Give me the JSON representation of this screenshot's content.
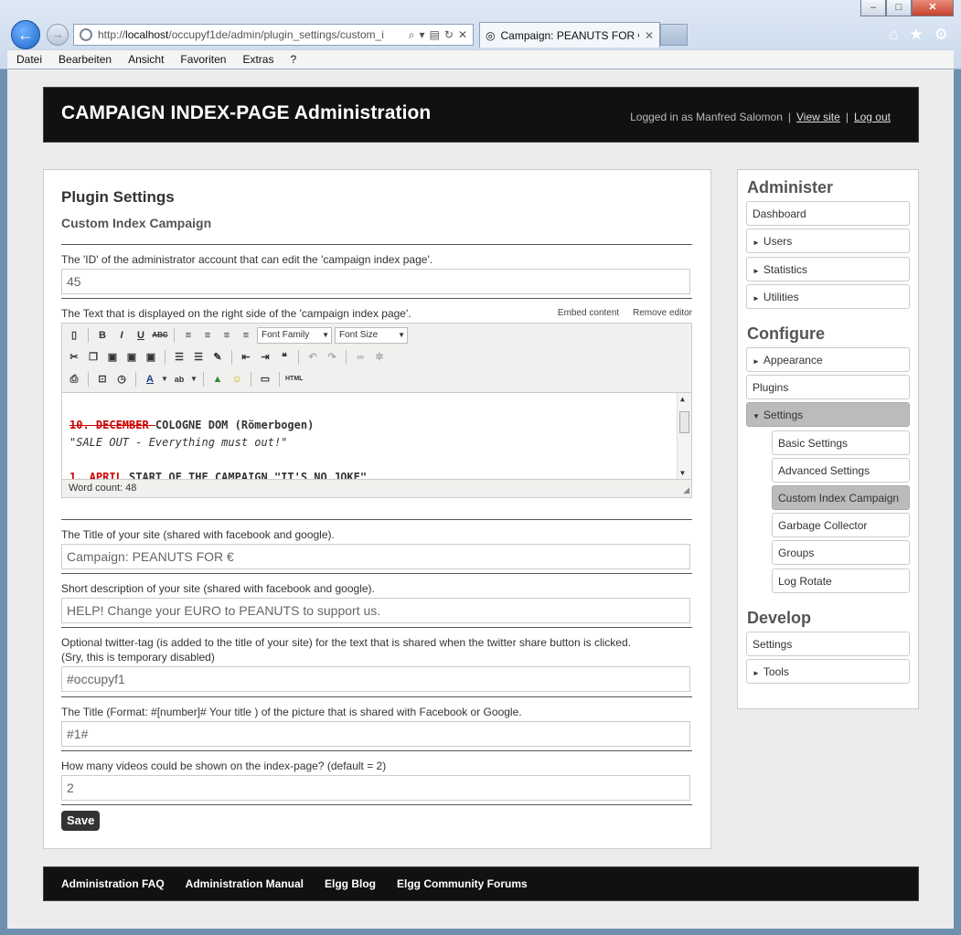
{
  "browser": {
    "url_prefix": "http://",
    "url_host": "localhost",
    "url_rest": "/occupyf1de/admin/plugin_settings/custom_i",
    "tab_title": "Campaign: PEANUTS FOR €",
    "menu": [
      "Datei",
      "Bearbeiten",
      "Ansicht",
      "Favoriten",
      "Extras",
      "?"
    ]
  },
  "header": {
    "title": "CAMPAIGN INDEX-PAGE Administration",
    "logged_in": "Logged in as Manfred Salomon",
    "view_site": "View site",
    "log_out": "Log out"
  },
  "main": {
    "title": "Plugin Settings",
    "subtitle": "Custom Index Campaign",
    "admin_id_label": "The 'ID' of the administrator account that can edit the 'campaign index page'.",
    "admin_id_value": "45",
    "text_label": "The Text that is displayed on the right side of the 'campaign index page'.",
    "embed_content": "Embed content",
    "remove_editor": "Remove editor",
    "font_family": "Font Family",
    "font_size": "Font Size",
    "editor_line1_date": "10. DECEMBER ",
    "editor_line1_rest": "COLOGNE DOM (Römerbogen)",
    "editor_line2": "\"SALE OUT - Everything must out!\"",
    "editor_line3_date": "1. APRIL",
    "editor_line3_rest": " START OF THE CAMPAIGN \"IT'S NO JOKE\"",
    "word_count": "Word count: 48",
    "site_title_label": "The Title of your site (shared with facebook and google).",
    "site_title_value": "Campaign: PEANUTS FOR €",
    "short_desc_label": "Short description of your site (shared with facebook and google).",
    "short_desc_value": "HELP! Change your EURO to PEANUTS to support us.",
    "twitter_label": "Optional twitter-tag (is added to the title of your site) for the text that is shared when the twitter share button is clicked.",
    "twitter_note": "(Sry, this is temporary disabled)",
    "twitter_value": "#occupyf1",
    "picture_title_label": "The Title (Format: #[number]# Your title ) of the picture that is shared with Facebook or Google.",
    "picture_title_value": "#1#",
    "videos_label": "How many videos could be shown on the index-page? (default = 2)",
    "videos_value": "2",
    "save": "Save"
  },
  "sidebar": {
    "administer": "Administer",
    "dashboard": "Dashboard",
    "users": "Users",
    "statistics": "Statistics",
    "utilities": "Utilities",
    "configure": "Configure",
    "appearance": "Appearance",
    "plugins": "Plugins",
    "settings": "Settings",
    "basic_settings": "Basic Settings",
    "advanced_settings": "Advanced Settings",
    "custom_index_campaign": "Custom Index Campaign",
    "garbage_collector": "Garbage Collector",
    "groups": "Groups",
    "log_rotate": "Log Rotate",
    "develop": "Develop",
    "dev_settings": "Settings",
    "tools": "Tools"
  },
  "footer": {
    "links": [
      "Administration FAQ",
      "Administration Manual",
      "Elgg Blog",
      "Elgg Community Forums"
    ]
  }
}
